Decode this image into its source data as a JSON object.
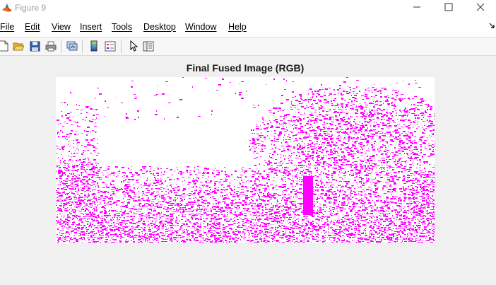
{
  "window": {
    "title": "Figure 9"
  },
  "menu": [
    {
      "label": "File"
    },
    {
      "label": "Edit"
    },
    {
      "label": "View"
    },
    {
      "label": "Insert"
    },
    {
      "label": "Tools"
    },
    {
      "label": "Desktop"
    },
    {
      "label": "Window"
    },
    {
      "label": "Help"
    }
  ],
  "toolbar": {
    "buttons": [
      "new-figure-icon",
      "open-file-icon",
      "save-icon",
      "print-icon",
      "link-plot-icon",
      "insert-colorbar-icon",
      "insert-legend-icon",
      "edit-plot-icon",
      "property-inspector-icon"
    ]
  },
  "figure": {
    "title": "Final Fused Image (RGB)",
    "image_color": "#ff00ff",
    "background_color": "#ffffff"
  },
  "colors": {
    "window_bg": "#f0f0f0",
    "menubar_bg": "#ffffff"
  }
}
